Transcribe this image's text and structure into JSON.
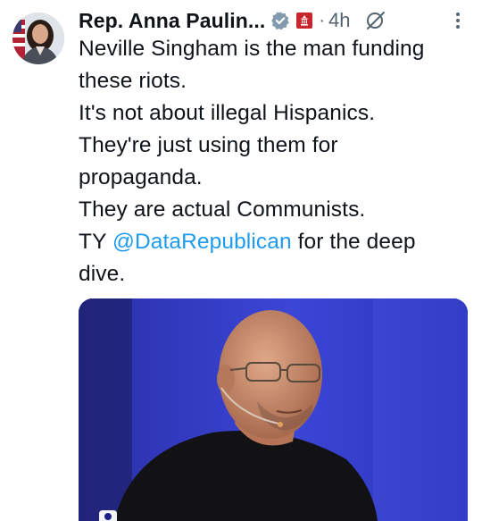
{
  "tweet": {
    "author_name": "Rep. Anna Paulin...",
    "separator": "·",
    "timestamp": "4h",
    "lines": [
      "Neville Singham is the man funding",
      "these riots.",
      "It's not about illegal Hispanics.",
      "They're just using them for",
      "propaganda.",
      "They are actual Communists."
    ],
    "last_line_prefix": "TY ",
    "mention": "@DataRepublican",
    "last_line_suffix": " for the deep",
    "final_line": "dive."
  },
  "icons": {
    "verified": "verified-badge-icon",
    "government": "government-badge-icon",
    "grok": "grok-icon",
    "more": "more-options-icon",
    "media_overlay": "media-icon"
  },
  "colors": {
    "text": "#0f1419",
    "secondary": "#536471",
    "link": "#1d9bf0",
    "verified_badge": "#829aab",
    "gov_badge": "#c8262c"
  }
}
